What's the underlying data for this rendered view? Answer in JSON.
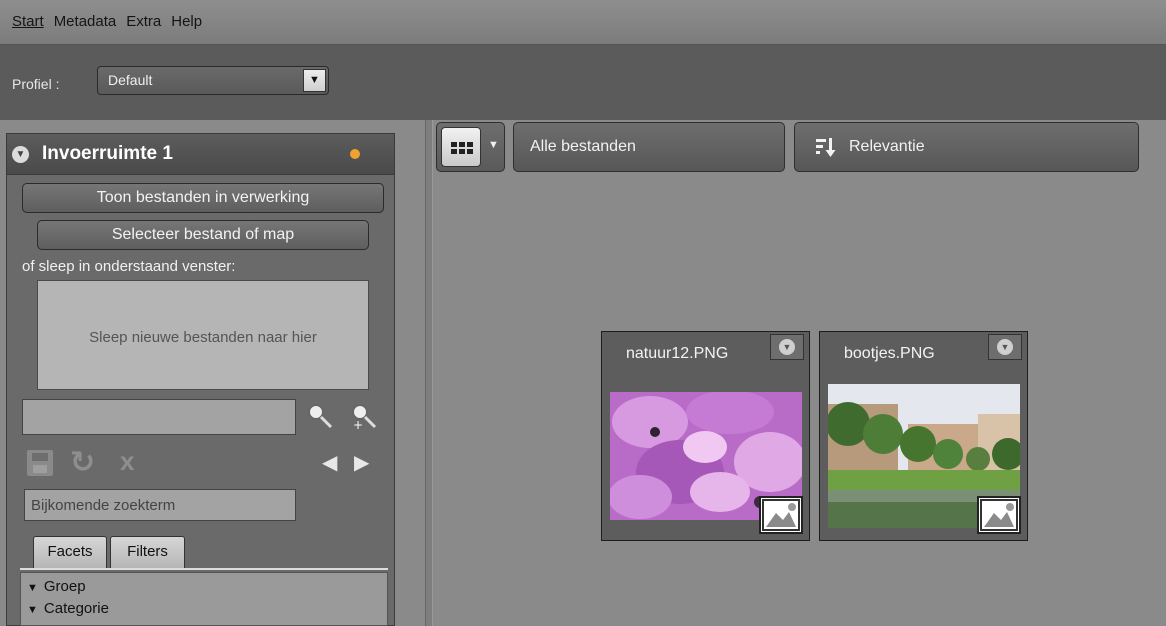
{
  "menu": [
    "Start",
    "Metadata",
    "Extra",
    "Help"
  ],
  "profile": {
    "label": "Profiel :",
    "value": "Default"
  },
  "panel": {
    "title": "Invoerruimte 1",
    "show_processing": "Toon bestanden in verwerking",
    "select_file": "Selecteer bestand of map",
    "drop_hint": "of sleep in onderstaand venster:",
    "drop_zone": "Sleep nieuwe bestanden naar hier",
    "extra_term_placeholder": "Bijkomende zoekterm",
    "tabs": [
      "Facets",
      "Filters"
    ],
    "facets": [
      "Groep",
      "Categorie"
    ]
  },
  "toolbar": {
    "all_files": "Alle bestanden",
    "sort": "Relevantie"
  },
  "files": [
    {
      "name": "natuur12.PNG"
    },
    {
      "name": "bootjes.PNG"
    }
  ],
  "colors": {
    "status_dot": "#f0a230",
    "background": "#8a8a8a"
  }
}
